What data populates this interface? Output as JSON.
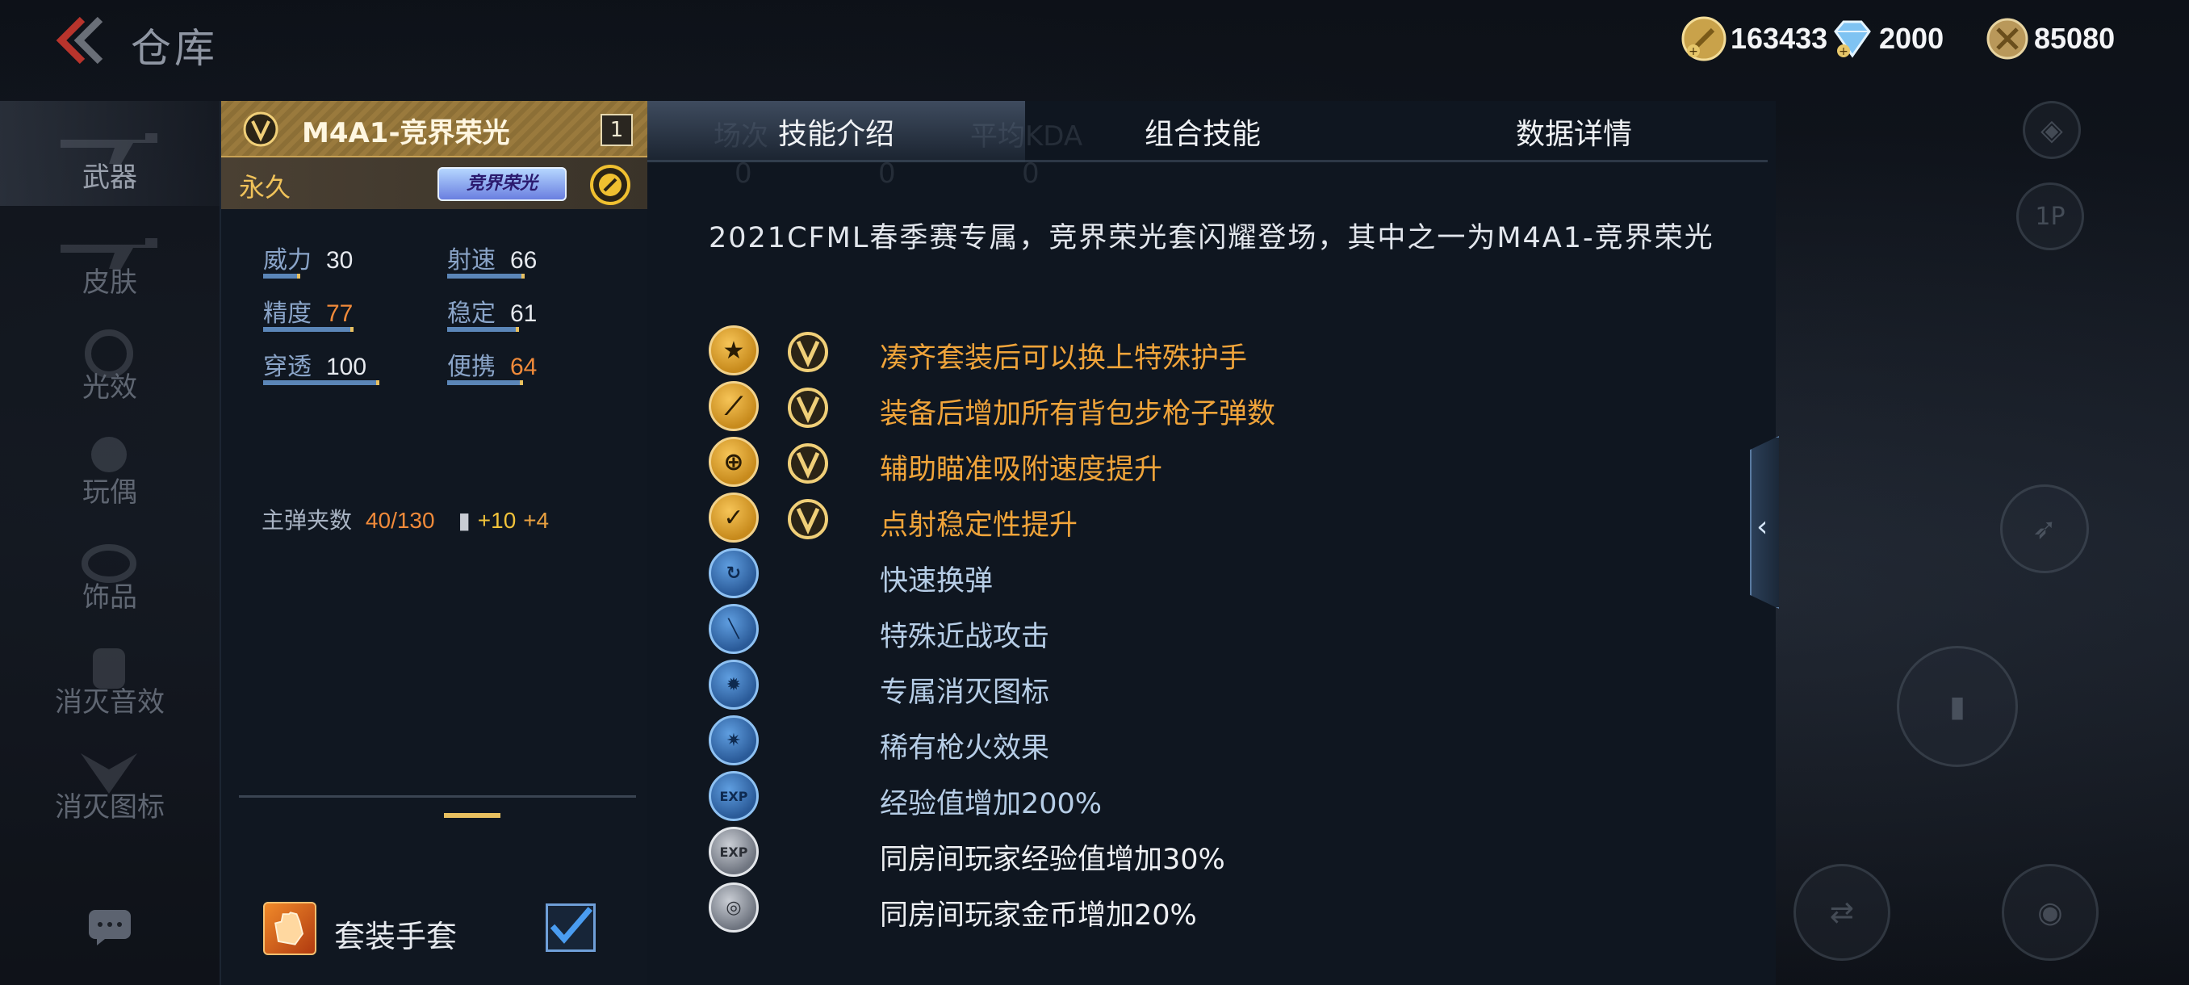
{
  "header": {
    "title": "仓库",
    "currencies": [
      {
        "icon": "gold-coin-icon",
        "value": "163433"
      },
      {
        "icon": "diamond-icon",
        "value": "2000"
      },
      {
        "icon": "honor-coin-icon",
        "value": "85080"
      }
    ]
  },
  "sidebar": {
    "items": [
      {
        "label": "武器",
        "active": true
      },
      {
        "label": "皮肤"
      },
      {
        "label": "光效"
      },
      {
        "label": "玩偶"
      },
      {
        "label": "饰品"
      },
      {
        "label": "消灭音效"
      },
      {
        "label": "消灭图标"
      }
    ]
  },
  "weapon": {
    "name": "M4A1-竞界荣光",
    "count": "1",
    "duration": "永久",
    "tag": "竞界荣光",
    "stats": [
      {
        "label": "威力",
        "value": "30",
        "fill": 0.3
      },
      {
        "label": "射速",
        "value": "66",
        "fill": 0.66
      },
      {
        "label": "精度",
        "value": "77",
        "fill": 0.77
      },
      {
        "label": "稳定",
        "value": "61",
        "fill": 0.61
      },
      {
        "label": "穿透",
        "value": "100",
        "fill": 1.0
      },
      {
        "label": "便携",
        "value": "64",
        "fill": 0.64
      }
    ],
    "ammo_label": "主弹夹数",
    "ammo_value": "40/130",
    "ammo_bonus1": "+10",
    "ammo_bonus2": "+4",
    "set_glove_label": "套装手套",
    "set_glove_checked": true
  },
  "tabs": [
    {
      "label": "技能介绍",
      "active": true
    },
    {
      "label": "组合技能"
    },
    {
      "label": "数据详情"
    }
  ],
  "ghost_tabs": [
    "场次",
    "平均KDA",
    "0",
    "0",
    "0"
  ],
  "description": "2021CFML春季赛专属，竞界荣光套闪耀登场，其中之一为M4A1-竞界荣光",
  "skills": [
    {
      "icon": "star-icon",
      "tier": "gold",
      "v": true,
      "text": "凑齐套装后可以换上特殊护手"
    },
    {
      "icon": "rifle-ammo-icon",
      "tier": "gold",
      "v": true,
      "text": "装备后增加所有背包步枪子弹数"
    },
    {
      "icon": "crosshair-icon",
      "tier": "gold",
      "v": true,
      "text": "辅助瞄准吸附速度提升"
    },
    {
      "icon": "burst-stability-icon",
      "tier": "gold",
      "v": true,
      "text": "点射稳定性提升"
    },
    {
      "icon": "fast-reload-icon",
      "tier": "blue",
      "v": false,
      "text": "快速换弹"
    },
    {
      "icon": "melee-icon",
      "tier": "blue",
      "v": false,
      "text": "特殊近战攻击"
    },
    {
      "icon": "kill-icon-badge-icon",
      "tier": "blue",
      "v": false,
      "text": "专属消灭图标"
    },
    {
      "icon": "muzzle-flash-icon",
      "tier": "blue",
      "v": false,
      "text": "稀有枪火效果"
    },
    {
      "icon": "exp-icon",
      "tier": "blue",
      "v": false,
      "text": "经验值增加200%"
    },
    {
      "icon": "room-exp-icon",
      "tier": "gray",
      "v": false,
      "text": "同房间玩家经验值增加30%"
    },
    {
      "icon": "room-coin-icon",
      "tier": "gray",
      "v": false,
      "text": "同房间玩家金币增加20%"
    }
  ],
  "colors": {
    "gold_text": "#f0a43a",
    "blue_text": "#b6cde6",
    "accent_bar": "#5b86b8",
    "panel_bg": "#0f1620"
  }
}
